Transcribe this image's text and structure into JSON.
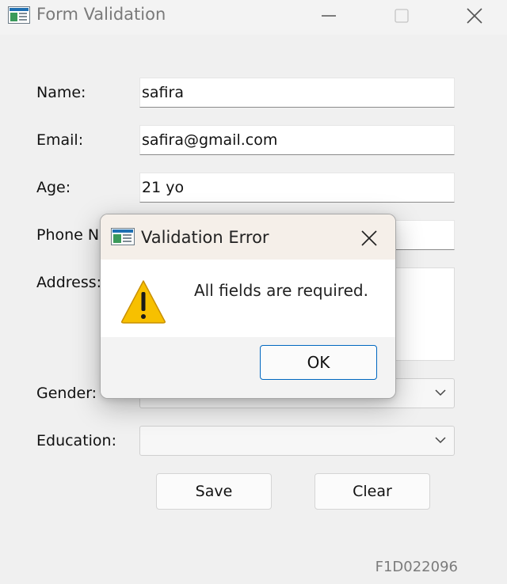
{
  "window": {
    "title": "Form Validation",
    "controls": {
      "minimize": "minimize",
      "maximize": "maximize",
      "close": "close"
    }
  },
  "form": {
    "name_label": "Name:",
    "name_value": "safira",
    "email_label": "Email:",
    "email_value": "safira@gmail.com",
    "age_label": "Age:",
    "age_value": "21 yo",
    "phone_label": "Phone No:",
    "phone_value": "",
    "address_label": "Address:",
    "address_value": "",
    "gender_label": "Gender:",
    "gender_value": "",
    "education_label": "Education:",
    "education_value": "",
    "save_label": "Save",
    "clear_label": "Clear"
  },
  "footer": {
    "id_text": "F1D022096"
  },
  "dialog": {
    "title": "Validation Error",
    "message": "All fields are required.",
    "ok_label": "OK",
    "icon": "warning-icon"
  },
  "colors": {
    "window_bg": "#f0f0f0",
    "dialog_title_bg": "#f5efe9",
    "ok_border": "#0067c0",
    "warning_fill": "#f7c000"
  }
}
